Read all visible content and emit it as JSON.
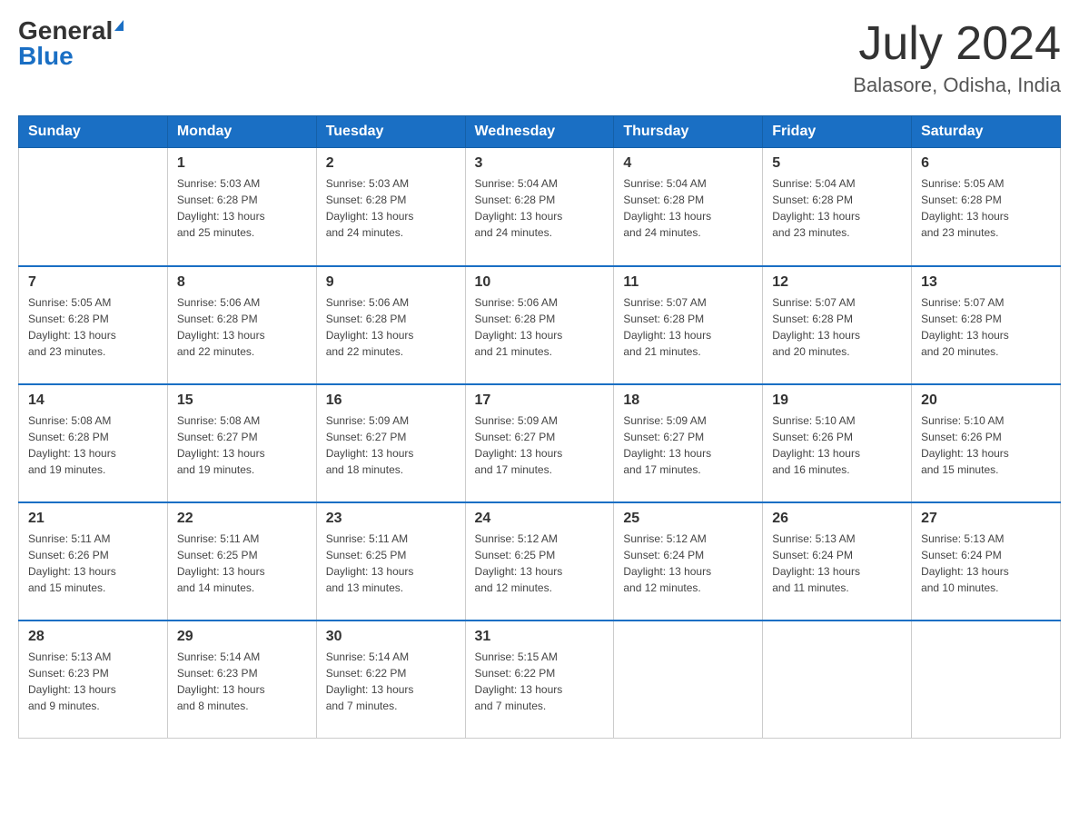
{
  "header": {
    "logo_general": "General",
    "logo_blue": "Blue",
    "month_title": "July 2024",
    "location": "Balasore, Odisha, India"
  },
  "days_of_week": [
    "Sunday",
    "Monday",
    "Tuesday",
    "Wednesday",
    "Thursday",
    "Friday",
    "Saturday"
  ],
  "weeks": [
    [
      {
        "day": "",
        "info": ""
      },
      {
        "day": "1",
        "info": "Sunrise: 5:03 AM\nSunset: 6:28 PM\nDaylight: 13 hours\nand 25 minutes."
      },
      {
        "day": "2",
        "info": "Sunrise: 5:03 AM\nSunset: 6:28 PM\nDaylight: 13 hours\nand 24 minutes."
      },
      {
        "day": "3",
        "info": "Sunrise: 5:04 AM\nSunset: 6:28 PM\nDaylight: 13 hours\nand 24 minutes."
      },
      {
        "day": "4",
        "info": "Sunrise: 5:04 AM\nSunset: 6:28 PM\nDaylight: 13 hours\nand 24 minutes."
      },
      {
        "day": "5",
        "info": "Sunrise: 5:04 AM\nSunset: 6:28 PM\nDaylight: 13 hours\nand 23 minutes."
      },
      {
        "day": "6",
        "info": "Sunrise: 5:05 AM\nSunset: 6:28 PM\nDaylight: 13 hours\nand 23 minutes."
      }
    ],
    [
      {
        "day": "7",
        "info": "Sunrise: 5:05 AM\nSunset: 6:28 PM\nDaylight: 13 hours\nand 23 minutes."
      },
      {
        "day": "8",
        "info": "Sunrise: 5:06 AM\nSunset: 6:28 PM\nDaylight: 13 hours\nand 22 minutes."
      },
      {
        "day": "9",
        "info": "Sunrise: 5:06 AM\nSunset: 6:28 PM\nDaylight: 13 hours\nand 22 minutes."
      },
      {
        "day": "10",
        "info": "Sunrise: 5:06 AM\nSunset: 6:28 PM\nDaylight: 13 hours\nand 21 minutes."
      },
      {
        "day": "11",
        "info": "Sunrise: 5:07 AM\nSunset: 6:28 PM\nDaylight: 13 hours\nand 21 minutes."
      },
      {
        "day": "12",
        "info": "Sunrise: 5:07 AM\nSunset: 6:28 PM\nDaylight: 13 hours\nand 20 minutes."
      },
      {
        "day": "13",
        "info": "Sunrise: 5:07 AM\nSunset: 6:28 PM\nDaylight: 13 hours\nand 20 minutes."
      }
    ],
    [
      {
        "day": "14",
        "info": "Sunrise: 5:08 AM\nSunset: 6:28 PM\nDaylight: 13 hours\nand 19 minutes."
      },
      {
        "day": "15",
        "info": "Sunrise: 5:08 AM\nSunset: 6:27 PM\nDaylight: 13 hours\nand 19 minutes."
      },
      {
        "day": "16",
        "info": "Sunrise: 5:09 AM\nSunset: 6:27 PM\nDaylight: 13 hours\nand 18 minutes."
      },
      {
        "day": "17",
        "info": "Sunrise: 5:09 AM\nSunset: 6:27 PM\nDaylight: 13 hours\nand 17 minutes."
      },
      {
        "day": "18",
        "info": "Sunrise: 5:09 AM\nSunset: 6:27 PM\nDaylight: 13 hours\nand 17 minutes."
      },
      {
        "day": "19",
        "info": "Sunrise: 5:10 AM\nSunset: 6:26 PM\nDaylight: 13 hours\nand 16 minutes."
      },
      {
        "day": "20",
        "info": "Sunrise: 5:10 AM\nSunset: 6:26 PM\nDaylight: 13 hours\nand 15 minutes."
      }
    ],
    [
      {
        "day": "21",
        "info": "Sunrise: 5:11 AM\nSunset: 6:26 PM\nDaylight: 13 hours\nand 15 minutes."
      },
      {
        "day": "22",
        "info": "Sunrise: 5:11 AM\nSunset: 6:25 PM\nDaylight: 13 hours\nand 14 minutes."
      },
      {
        "day": "23",
        "info": "Sunrise: 5:11 AM\nSunset: 6:25 PM\nDaylight: 13 hours\nand 13 minutes."
      },
      {
        "day": "24",
        "info": "Sunrise: 5:12 AM\nSunset: 6:25 PM\nDaylight: 13 hours\nand 12 minutes."
      },
      {
        "day": "25",
        "info": "Sunrise: 5:12 AM\nSunset: 6:24 PM\nDaylight: 13 hours\nand 12 minutes."
      },
      {
        "day": "26",
        "info": "Sunrise: 5:13 AM\nSunset: 6:24 PM\nDaylight: 13 hours\nand 11 minutes."
      },
      {
        "day": "27",
        "info": "Sunrise: 5:13 AM\nSunset: 6:24 PM\nDaylight: 13 hours\nand 10 minutes."
      }
    ],
    [
      {
        "day": "28",
        "info": "Sunrise: 5:13 AM\nSunset: 6:23 PM\nDaylight: 13 hours\nand 9 minutes."
      },
      {
        "day": "29",
        "info": "Sunrise: 5:14 AM\nSunset: 6:23 PM\nDaylight: 13 hours\nand 8 minutes."
      },
      {
        "day": "30",
        "info": "Sunrise: 5:14 AM\nSunset: 6:22 PM\nDaylight: 13 hours\nand 7 minutes."
      },
      {
        "day": "31",
        "info": "Sunrise: 5:15 AM\nSunset: 6:22 PM\nDaylight: 13 hours\nand 7 minutes."
      },
      {
        "day": "",
        "info": ""
      },
      {
        "day": "",
        "info": ""
      },
      {
        "day": "",
        "info": ""
      }
    ]
  ]
}
